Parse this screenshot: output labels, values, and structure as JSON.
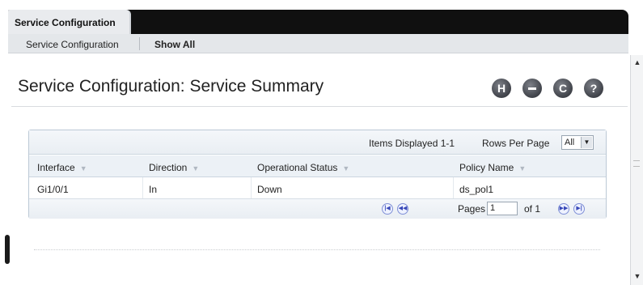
{
  "tabs": [
    {
      "label": "Service Configuration",
      "active": true
    }
  ],
  "subnav": {
    "items": [
      {
        "label": "Service Configuration"
      },
      {
        "label": "Show All"
      }
    ]
  },
  "header": {
    "title": "Service Configuration: Service Summary",
    "icons": [
      {
        "name": "save-icon",
        "glyph": "H"
      },
      {
        "name": "print-icon",
        "glyph": "▬"
      },
      {
        "name": "refresh-icon",
        "glyph": "C"
      },
      {
        "name": "help-icon",
        "glyph": "?"
      }
    ]
  },
  "table": {
    "items_displayed": "Items Displayed 1-1",
    "rows_per_page_label": "Rows Per Page",
    "rows_per_page_value": "All",
    "columns": [
      "Interface",
      "Direction",
      "Operational Status",
      "Policy Name"
    ],
    "rows": [
      {
        "interface": "Gi1/0/1",
        "direction": "In",
        "status": "Down",
        "policy": "ds_pol1"
      }
    ],
    "pager": {
      "pages_label": "Pages",
      "current_page": "1",
      "of_label": "of 1"
    }
  },
  "colors": {
    "tabbar": "#101010",
    "accent_border": "#bcc9d6",
    "pager_button": "#3848b8"
  }
}
